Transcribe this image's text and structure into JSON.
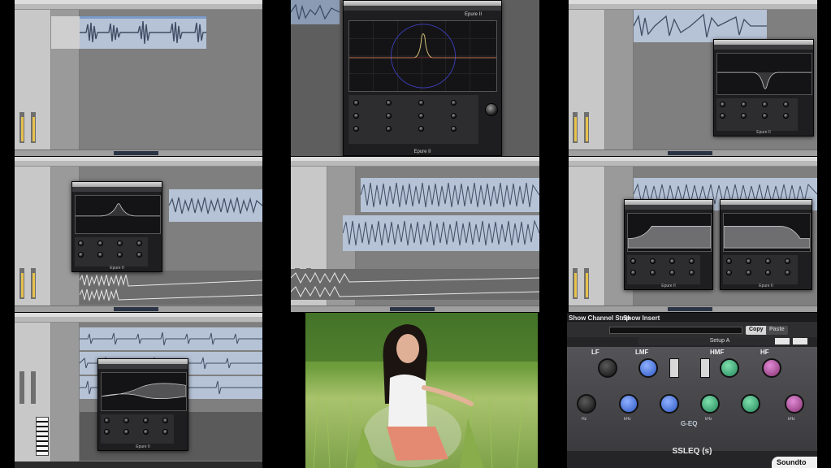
{
  "tiles": [
    {
      "id": 1,
      "kind": "logic-arrange",
      "regions": 1
    },
    {
      "id": 2,
      "kind": "plugin-large",
      "plugin_title": "Epure II",
      "plugin_footer": "Epure II"
    },
    {
      "id": 3,
      "kind": "logic-plugin",
      "plugin_title": "Epure II"
    },
    {
      "id": 4,
      "kind": "logic-plugin",
      "plugin_title": "Epure II"
    },
    {
      "id": 5,
      "kind": "logic-arrange-dense"
    },
    {
      "id": 6,
      "kind": "logic-two-plugins",
      "plugin_title": "Epure II"
    },
    {
      "id": 7,
      "kind": "logic-plugin-piano",
      "plugin_title": "Epure II"
    },
    {
      "id": 8,
      "kind": "photo"
    },
    {
      "id": 9,
      "kind": "ssl-eq"
    }
  ],
  "ssl": {
    "show_channel_strip": "Show Channel Strip",
    "show_insert": "Show Insert",
    "preset": "Setup A",
    "copy": "Copy",
    "paste": "Paste",
    "bands": [
      "LF",
      "LMF",
      "HMF",
      "HF"
    ],
    "geq": "G-EQ",
    "plugin_name": "SSLEQ (s)",
    "brand": "Soundto",
    "unit_hz": "Hz",
    "unit_khz": "kHz",
    "colors": {
      "blue": "#3f6fd6",
      "green": "#2f9f6a",
      "purple": "#9a3d91",
      "black": "#1b1b1b"
    }
  }
}
